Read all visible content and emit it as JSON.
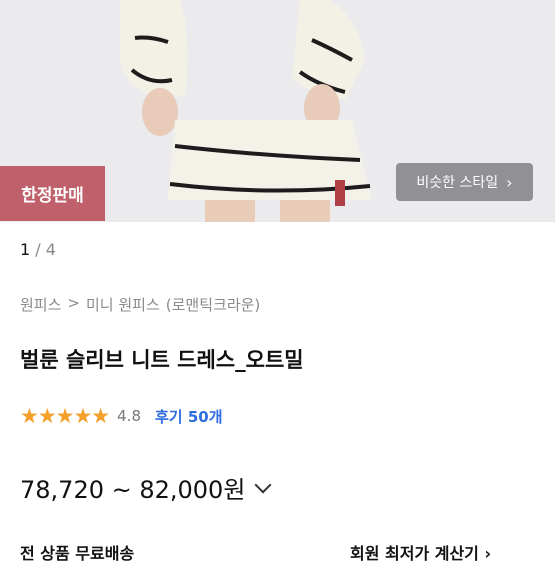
{
  "hero": {
    "badge_label": "한정판매",
    "similar_button_label": "비슷한 스타일",
    "similar_chevron": "chevron-right-icon"
  },
  "pager": {
    "current": "1",
    "separator": "/",
    "total": "4"
  },
  "breadcrumb": {
    "items": [
      "원피스",
      ">",
      "미니 원피스",
      "(로맨틱크라운)"
    ]
  },
  "product": {
    "title": "벌룬 슬리브 니트 드레스_오트밀",
    "stars": "★★★★★",
    "rating": "4.8",
    "reviews_label": "후기 50개",
    "price_range": "78,720 ~ 82,000원"
  },
  "bottom": {
    "left_text": "전 상품 무료배송",
    "right_text": "회원 최저가 계산기 ›"
  },
  "colors": {
    "badge": "#c0606a",
    "stars": "#f4a02a",
    "review_link": "#2d6cdf"
  }
}
